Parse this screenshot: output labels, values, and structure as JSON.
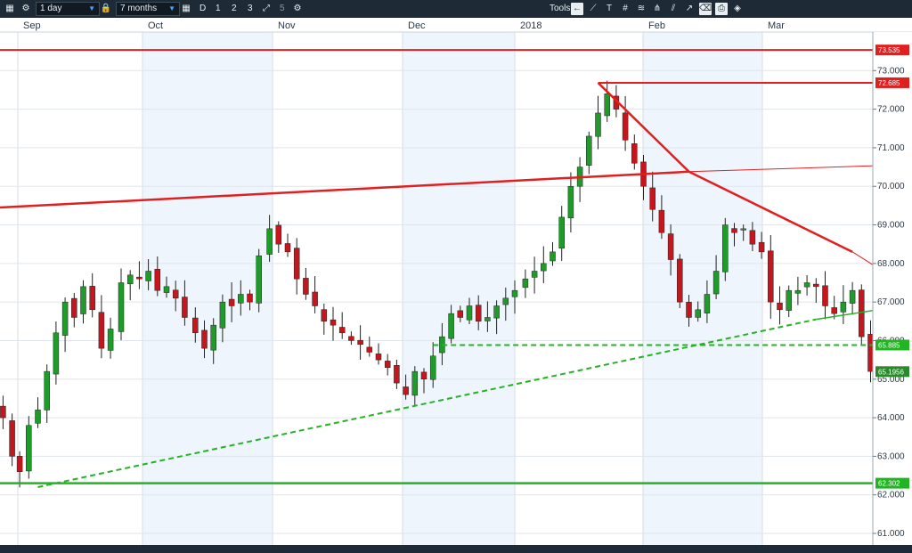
{
  "toolbar": {
    "interval": "1 day",
    "range": "7 months",
    "buttons": [
      "D",
      "1",
      "2",
      "3"
    ],
    "page": "5",
    "tools_label": "Tools"
  },
  "chart_data": {
    "type": "candlestick",
    "x_labels": [
      "Sep",
      "Oct",
      "Nov",
      "Dec",
      "2018",
      "Feb",
      "Mar"
    ],
    "y_ticks": [
      "61.000",
      "62.000",
      "63.000",
      "64.000",
      "65.000",
      "66.000",
      "67.000",
      "68.000",
      "69.000",
      "70.000",
      "71.000",
      "72.000",
      "73.000"
    ],
    "ylim": [
      60.7,
      74.0
    ],
    "price_tags": [
      {
        "value": 73.535,
        "label": "73.535",
        "color": "#e02020"
      },
      {
        "value": 72.685,
        "label": "72.685",
        "color": "#e02020"
      },
      {
        "value": 65.885,
        "label": "65.885",
        "color": "#23b423"
      },
      {
        "value": 65.1956,
        "label": "65.1956",
        "color": "#2a8a2a"
      },
      {
        "value": 62.302,
        "label": "62.302",
        "color": "#23b423"
      }
    ],
    "up_color": "#1f9b2a",
    "down_color": "#c4161c",
    "closes": [
      64.0,
      63.0,
      62.6,
      63.8,
      64.2,
      65.2,
      66.2,
      67.0,
      66.6,
      67.4,
      66.8,
      65.8,
      66.3,
      67.5,
      67.7,
      67.6,
      67.8,
      67.3,
      67.4,
      67.1,
      66.6,
      66.2,
      65.8,
      66.4,
      67.0,
      66.9,
      67.2,
      67.0,
      68.2,
      68.9,
      68.5,
      68.3,
      67.6,
      67.2,
      66.9,
      66.5,
      66.4,
      66.2,
      66.0,
      65.9,
      65.7,
      65.5,
      65.3,
      64.9,
      64.6,
      65.2,
      65.0,
      65.6,
      66.1,
      66.7,
      66.6,
      66.9,
      66.5,
      66.6,
      66.9,
      67.1,
      67.3,
      67.6,
      67.8,
      68.0,
      68.3,
      69.2,
      70.0,
      70.5,
      71.3,
      71.9,
      72.4,
      72.0,
      71.2,
      70.6,
      70.0,
      69.4,
      68.8,
      68.1,
      67.0,
      66.6,
      66.8,
      67.2,
      67.8,
      69.0,
      68.8,
      68.9,
      68.5,
      68.3,
      67.0,
      66.8,
      67.3,
      67.3,
      67.5,
      67.4,
      66.9,
      66.7,
      67.0,
      67.3,
      66.1,
      65.2
    ],
    "x_pos": [
      2,
      8,
      13,
      19,
      25,
      31,
      37,
      43,
      49,
      55,
      61,
      67,
      73,
      80,
      86,
      92,
      98,
      104,
      110,
      116,
      122,
      129,
      135,
      141,
      147,
      153,
      159,
      165,
      171,
      178,
      184,
      190,
      196,
      202,
      208,
      214,
      220,
      226,
      232,
      238,
      244,
      250,
      256,
      262,
      268,
      274,
      280,
      286,
      292,
      298,
      304,
      310,
      316,
      322,
      328,
      334,
      340,
      347,
      353,
      359,
      365,
      371,
      377,
      383,
      389,
      395,
      401,
      407,
      413,
      419,
      425,
      431,
      437,
      443,
      449,
      455,
      461,
      467,
      473,
      479,
      485,
      491,
      497,
      503,
      509,
      515,
      521,
      527,
      533,
      539,
      545,
      551,
      557,
      563,
      569,
      575
    ]
  }
}
